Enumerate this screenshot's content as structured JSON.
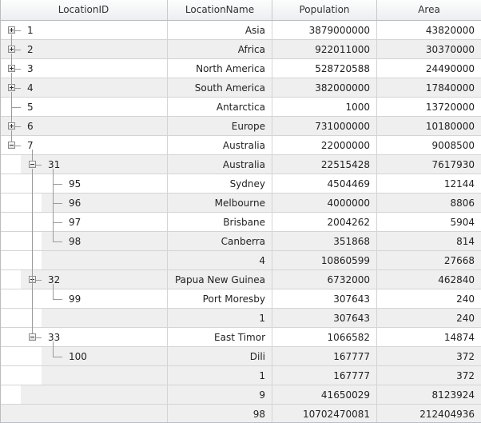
{
  "columns": [
    "LocationID",
    "LocationName",
    "Population",
    "Area"
  ],
  "rows": [
    {
      "level": 0,
      "kind": "data",
      "expander": "collapsed",
      "id": "1",
      "name": "Asia",
      "pop": "3879000000",
      "area": "43820000"
    },
    {
      "level": 0,
      "kind": "data",
      "expander": "collapsed",
      "id": "2",
      "name": "Africa",
      "pop": "922011000",
      "area": "30370000"
    },
    {
      "level": 0,
      "kind": "data",
      "expander": "collapsed",
      "id": "3",
      "name": "North America",
      "pop": "528720588",
      "area": "24490000"
    },
    {
      "level": 0,
      "kind": "data",
      "expander": "collapsed",
      "id": "4",
      "name": "South America",
      "pop": "382000000",
      "area": "17840000"
    },
    {
      "level": 0,
      "kind": "data",
      "expander": "none",
      "id": "5",
      "name": "Antarctica",
      "pop": "1000",
      "area": "13720000"
    },
    {
      "level": 0,
      "kind": "data",
      "expander": "collapsed",
      "id": "6",
      "name": "Europe",
      "pop": "731000000",
      "area": "10180000"
    },
    {
      "level": 0,
      "kind": "data",
      "expander": "expanded",
      "id": "7",
      "name": "Australia",
      "pop": "22000000",
      "area": "9008500"
    },
    {
      "level": 1,
      "kind": "data",
      "expander": "expanded",
      "id": "31",
      "name": "Australia",
      "pop": "22515428",
      "area": "7617930"
    },
    {
      "level": 2,
      "kind": "data",
      "expander": "none",
      "id": "95",
      "name": "Sydney",
      "pop": "4504469",
      "area": "12144"
    },
    {
      "level": 2,
      "kind": "data",
      "expander": "none",
      "id": "96",
      "name": "Melbourne",
      "pop": "4000000",
      "area": "8806"
    },
    {
      "level": 2,
      "kind": "data",
      "expander": "none",
      "id": "97",
      "name": "Brisbane",
      "pop": "2004262",
      "area": "5904"
    },
    {
      "level": 2,
      "kind": "data",
      "expander": "none",
      "id": "98",
      "name": "Canberra",
      "pop": "351868",
      "area": "814"
    },
    {
      "level": 2,
      "kind": "summary",
      "expander": "none",
      "id": "",
      "name": "4",
      "pop": "10860599",
      "area": "27668"
    },
    {
      "level": 1,
      "kind": "data",
      "expander": "expanded",
      "id": "32",
      "name": "Papua New Guinea",
      "pop": "6732000",
      "area": "462840"
    },
    {
      "level": 2,
      "kind": "data",
      "expander": "none",
      "id": "99",
      "name": "Port Moresby",
      "pop": "307643",
      "area": "240"
    },
    {
      "level": 2,
      "kind": "summary",
      "expander": "none",
      "id": "",
      "name": "1",
      "pop": "307643",
      "area": "240"
    },
    {
      "level": 1,
      "kind": "data",
      "expander": "expanded",
      "id": "33",
      "name": "East Timor",
      "pop": "1066582",
      "area": "14874"
    },
    {
      "level": 2,
      "kind": "data",
      "expander": "none",
      "id": "100",
      "name": "Dili",
      "pop": "167777",
      "area": "372"
    },
    {
      "level": 2,
      "kind": "summary",
      "expander": "none",
      "id": "",
      "name": "1",
      "pop": "167777",
      "area": "372"
    },
    {
      "level": 1,
      "kind": "summary",
      "expander": "none",
      "id": "",
      "name": "9",
      "pop": "41650029",
      "area": "8123924"
    },
    {
      "level": 0,
      "kind": "summary",
      "expander": "none",
      "id": "",
      "name": "98",
      "pop": "10702470081",
      "area": "212404936"
    }
  ],
  "colors": {
    "header_bg": "#eceef0",
    "alt_row": "#efefef",
    "grid_line": "#d4d4d4",
    "tree_line": "#9a9a9a"
  }
}
